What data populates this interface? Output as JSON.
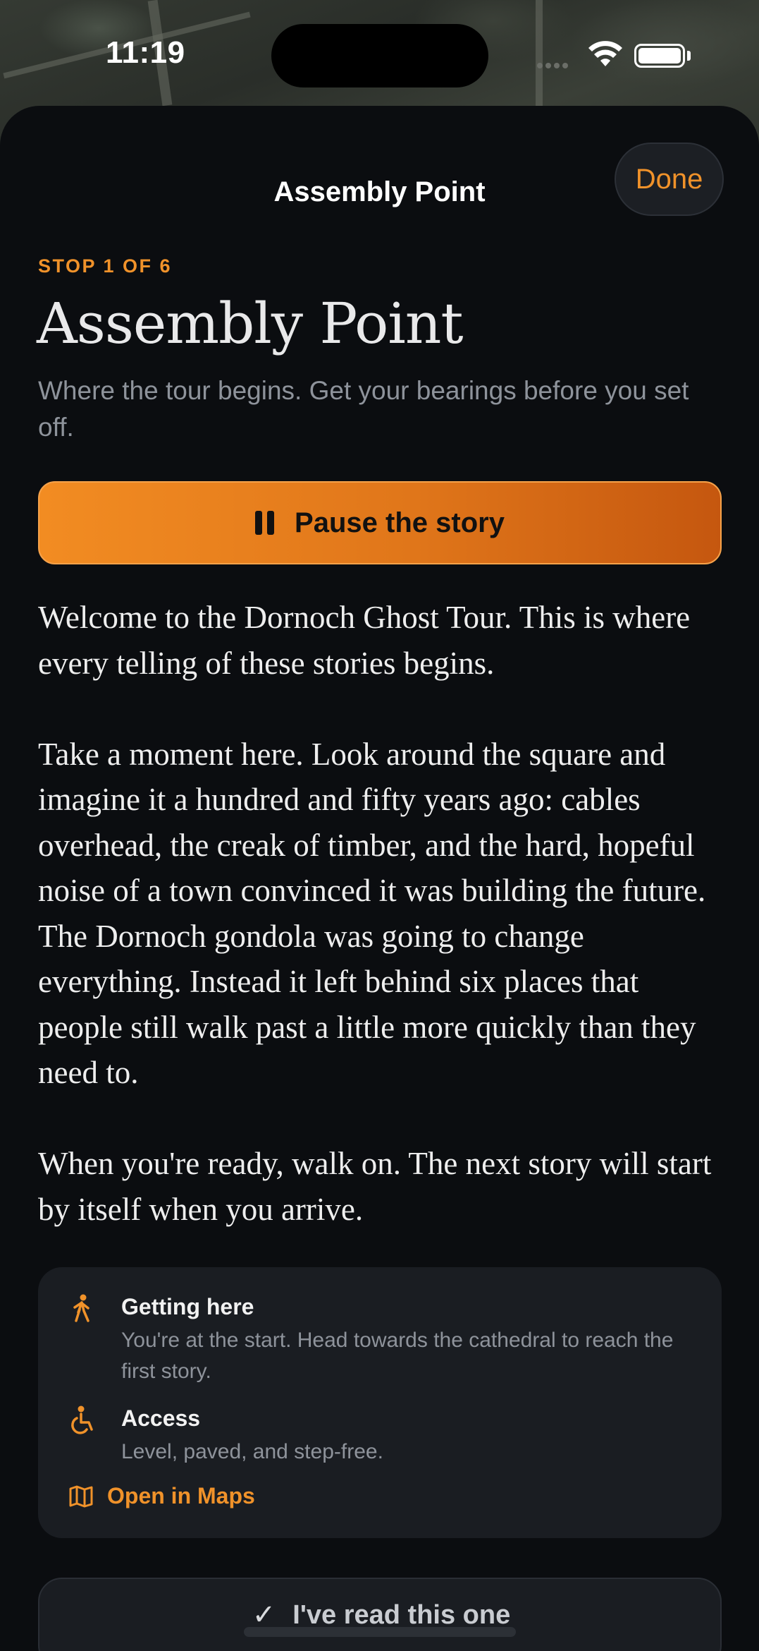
{
  "status_bar": {
    "time": "11:19"
  },
  "nav": {
    "title": "Assembly Point",
    "done_label": "Done"
  },
  "stop": {
    "label": "STOP 1 OF 6",
    "title": "Assembly Point",
    "subtitle": "Where the tour begins. Get your bearings before you set off."
  },
  "pause_button": {
    "label": "Pause the story"
  },
  "story": {
    "paragraphs": [
      "Welcome to the Dornoch Ghost Tour. This is where every telling of these stories begins.",
      "Take a moment here. Look around the square and imagine it a hundred and fifty years ago: cables overhead, the creak of timber, and the hard, hopeful noise of a town convinced it was building the future. The Dornoch gondola was going to change everything. Instead it left behind six places that people still walk past a little more quickly than they need to.",
      "When you're ready, walk on. The next story will start by itself when you arrive."
    ]
  },
  "info": {
    "getting_here": {
      "title": "Getting here",
      "text": "You're at the start. Head towards the cathedral to reach the first story."
    },
    "access": {
      "title": "Access",
      "text": "Level, paved, and step-free."
    },
    "maps_label": "Open in Maps"
  },
  "read_button": {
    "label": "I've read this one"
  },
  "colors": {
    "accent": "#f0922a",
    "background": "#0b0d10",
    "card": "#1a1d22"
  }
}
